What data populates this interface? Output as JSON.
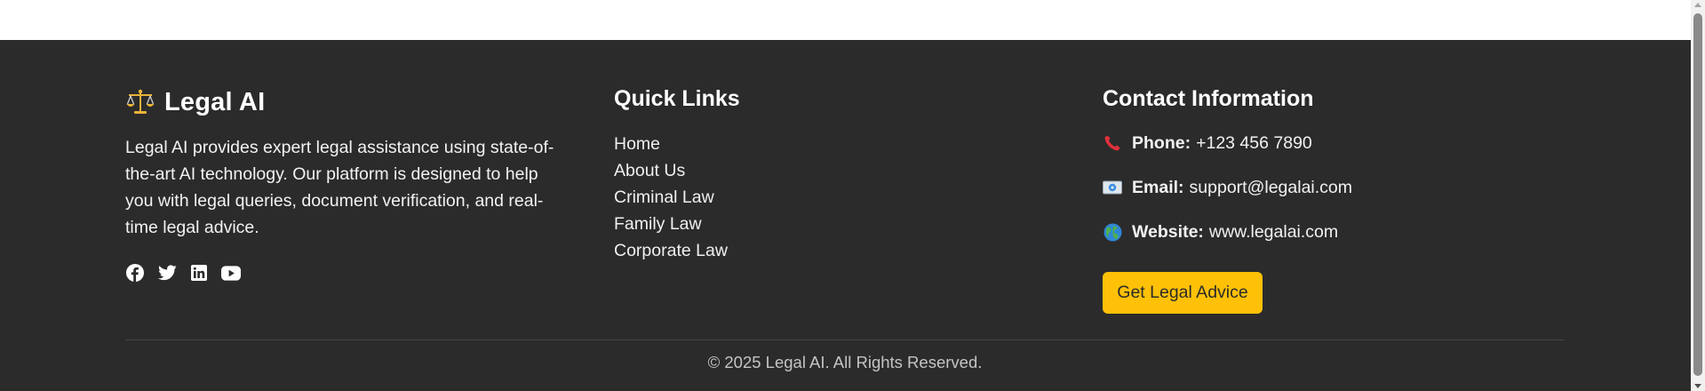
{
  "brand": {
    "name": "Legal AI",
    "icon": "scales-icon",
    "description": "Legal AI provides expert legal assistance using state-of-the-art AI technology. Our platform is designed to help you with legal queries, document verification, and real-time legal advice."
  },
  "social": [
    "facebook-icon",
    "twitter-icon",
    "linkedin-icon",
    "youtube-icon"
  ],
  "quick_links": {
    "title": "Quick Links",
    "items": [
      "Home",
      "About Us",
      "Criminal Law",
      "Family Law",
      "Corporate Law"
    ]
  },
  "contact": {
    "title": "Contact Information",
    "phone_label": "Phone:",
    "phone_value": "+123 456 7890",
    "email_label": "Email:",
    "email_value": "support@legalai.com",
    "website_label": "Website:",
    "website_value": "www.legalai.com",
    "cta_label": "Get Legal Advice"
  },
  "copyright": "© 2025 Legal AI. All Rights Reserved.",
  "colors": {
    "footer_bg": "#2b2b2b",
    "accent": "#ffc107",
    "text": "#ffffff"
  }
}
